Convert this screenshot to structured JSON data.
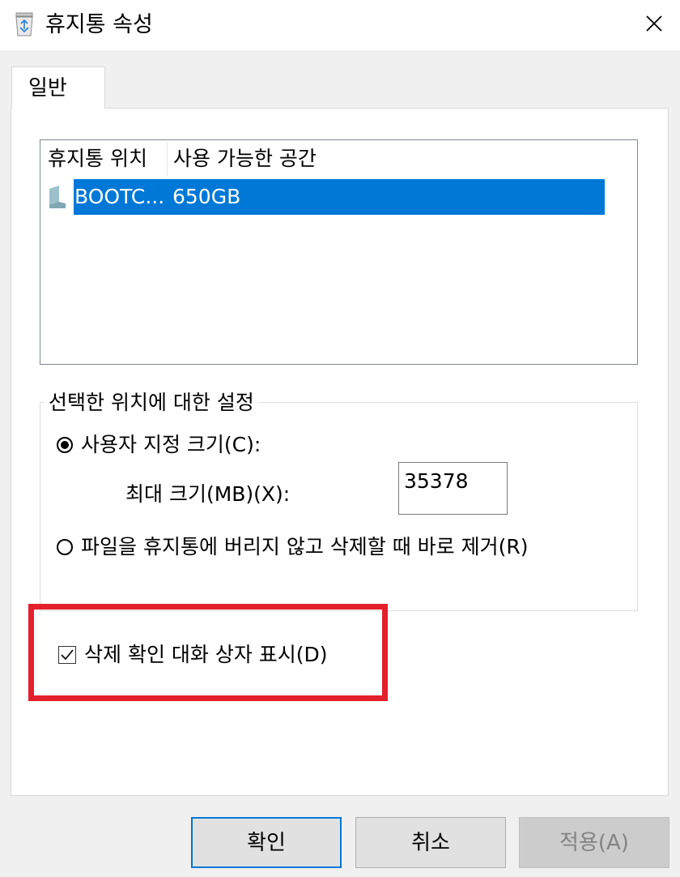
{
  "window": {
    "title": "휴지통 속성",
    "icon": "recycle-bin-icon",
    "close_icon": "close-icon"
  },
  "tabs": [
    {
      "label": "일반",
      "selected": true
    }
  ],
  "location_list": {
    "columns": [
      "휴지통 위치",
      "사용 가능한 공간"
    ],
    "rows": [
      {
        "icon": "drive-icon",
        "location": "BOOTC...",
        "free_space": "650GB",
        "selected": true
      }
    ]
  },
  "settings_group": {
    "label": "선택한 위치에 대한 설정",
    "custom_size_option": {
      "label": "사용자 지정 크기(C):",
      "selected": true
    },
    "max_size": {
      "label": "최대 크기(MB)(X):",
      "value": "35378"
    },
    "delete_immediately_option": {
      "label": "파일을 휴지통에 버리지 않고 삭제할 때 바로 제거(R)",
      "selected": false
    }
  },
  "confirm_checkbox": {
    "label": "삭제 확인 대화 상자 표시(D)",
    "checked": true
  },
  "highlight_color": "#e4202a",
  "buttons": {
    "ok": "확인",
    "cancel": "취소",
    "apply": "적용(A)"
  },
  "colors": {
    "selection": "#0078d7",
    "default_button_border": "#0078d7"
  }
}
